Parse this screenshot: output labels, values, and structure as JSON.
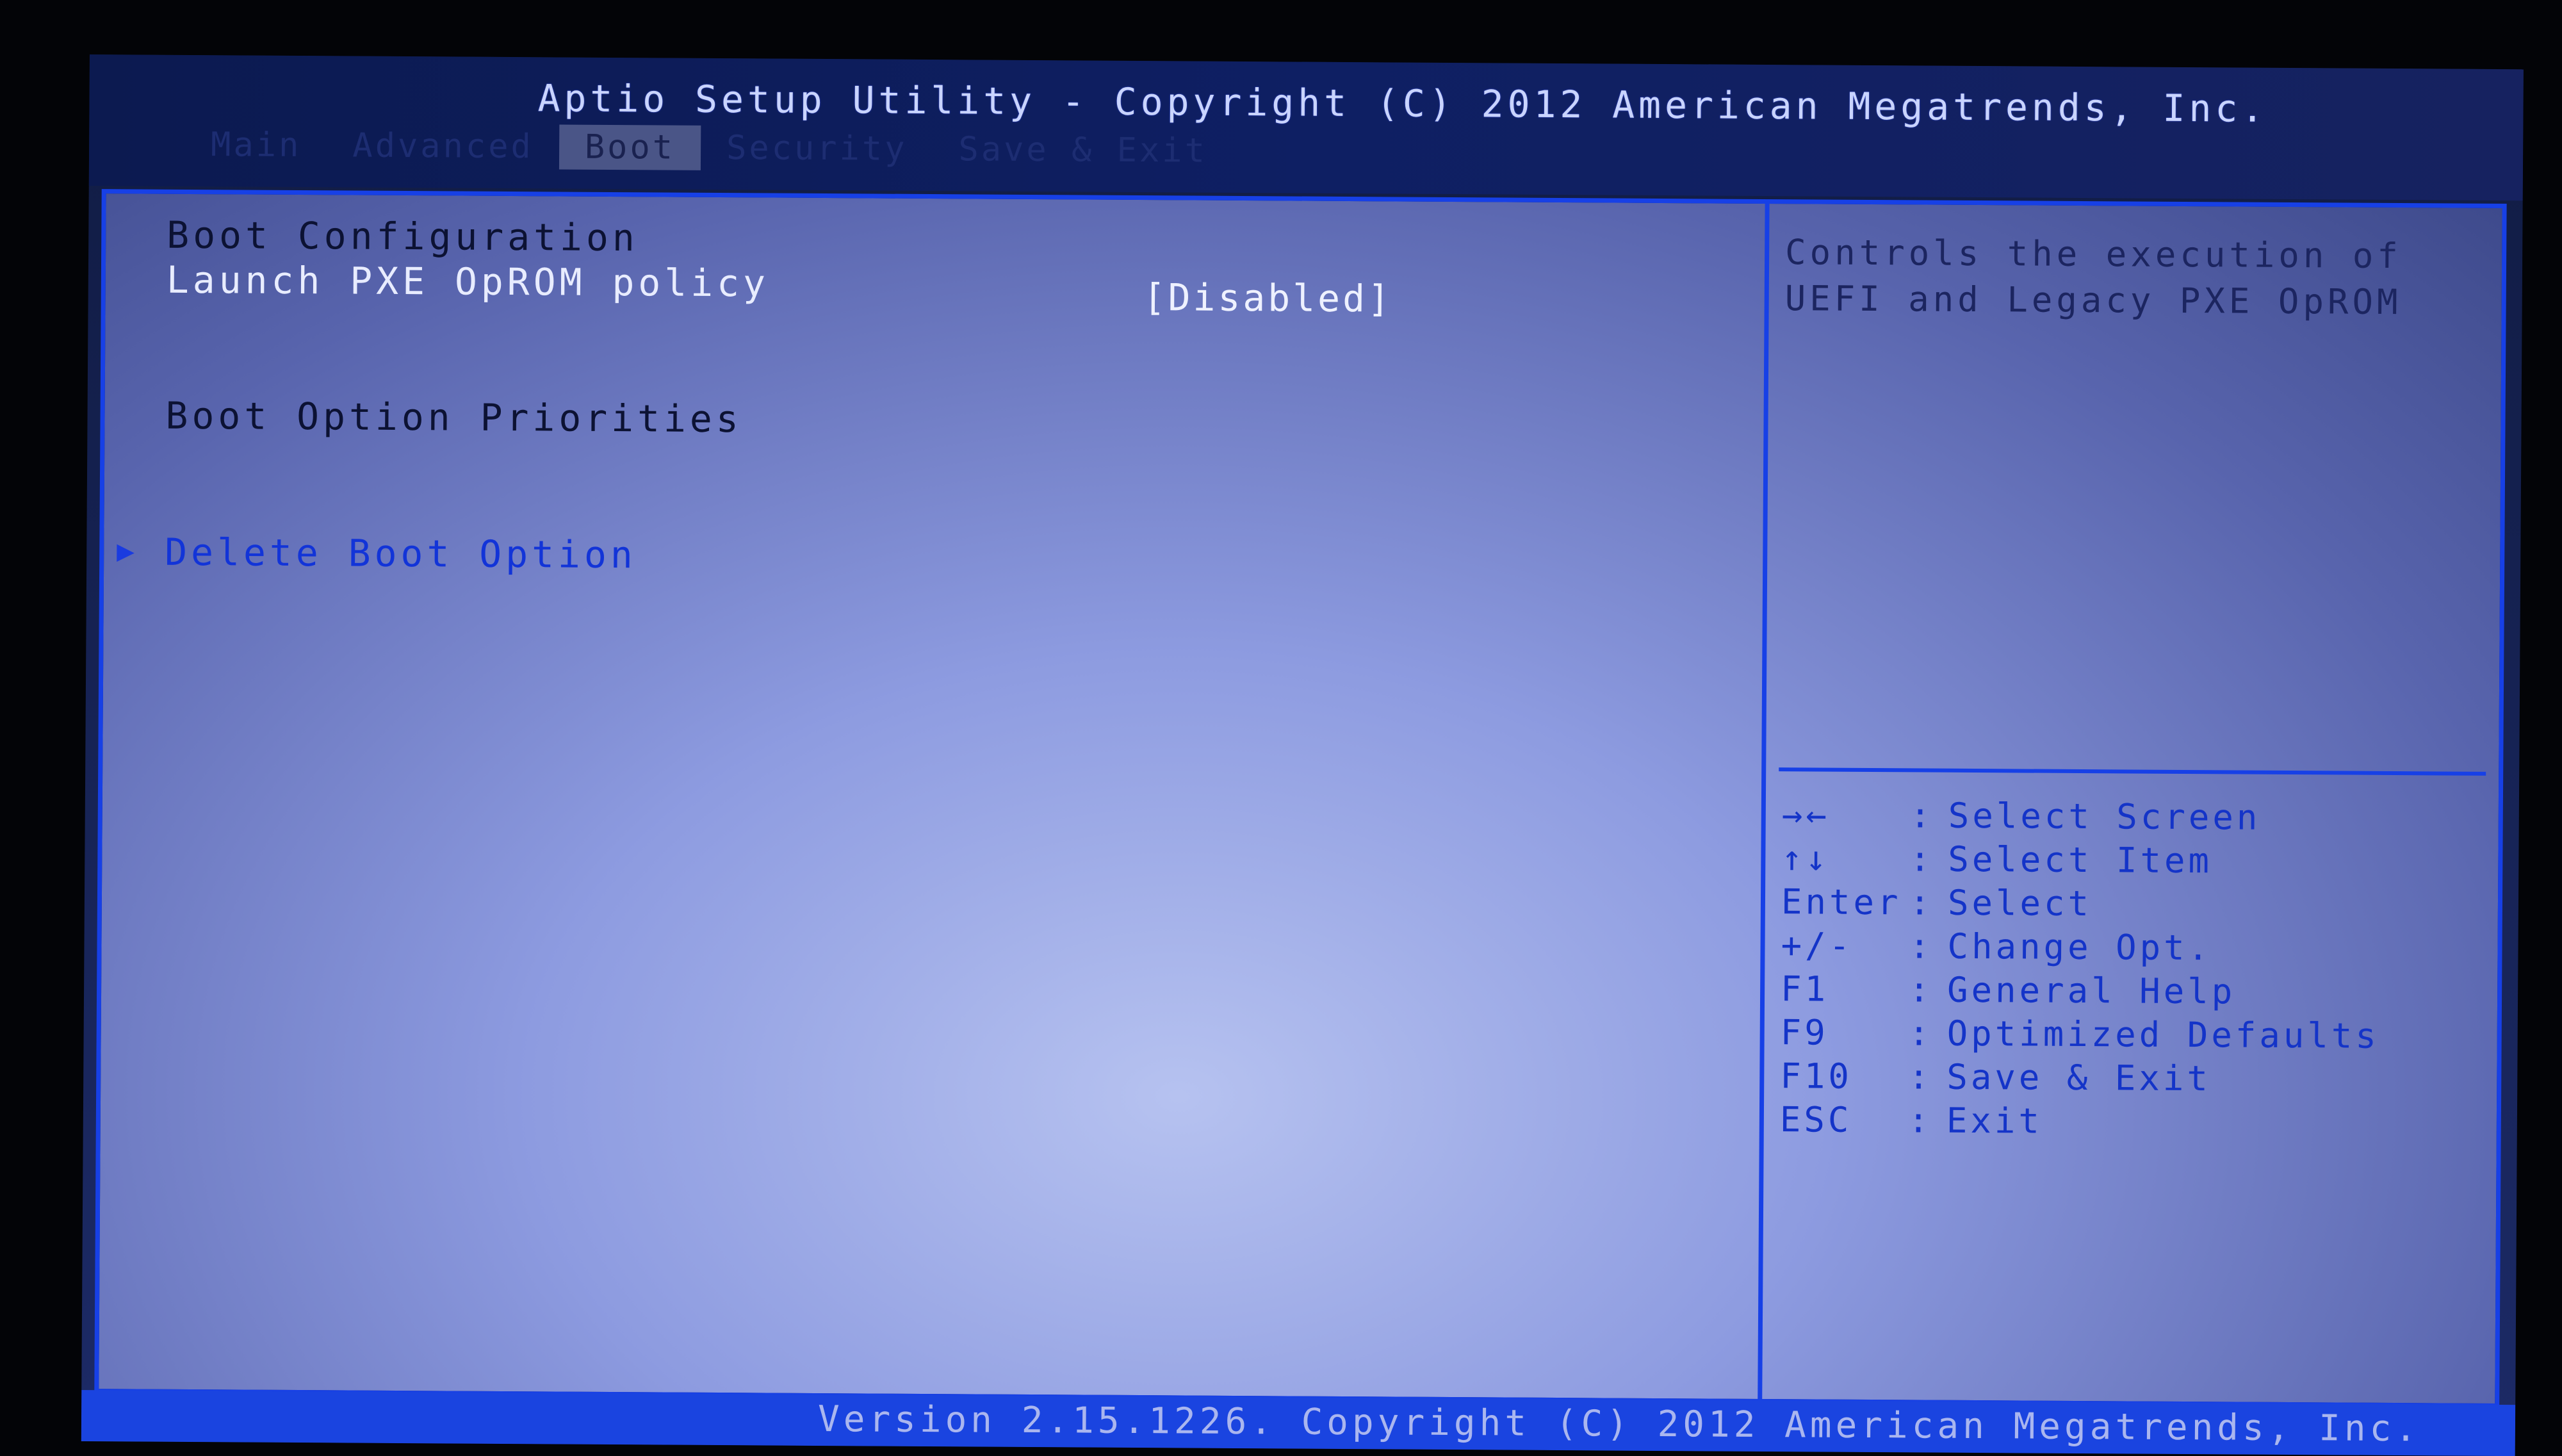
{
  "header": {
    "title": "Aptio Setup Utility - Copyright (C) 2012 American Megatrends, Inc."
  },
  "tabs": [
    {
      "label": "Main",
      "active": false
    },
    {
      "label": "Advanced",
      "active": false
    },
    {
      "label": "Boot",
      "active": true
    },
    {
      "label": "Security",
      "active": false
    },
    {
      "label": "Save & Exit",
      "active": false
    }
  ],
  "main": {
    "boot_configuration_heading": "Boot Configuration",
    "pxe_policy": {
      "label": "Launch PXE OpROM policy",
      "value": "[Disabled]"
    },
    "boot_priorities_heading": "Boot Option Priorities",
    "delete_boot_option": {
      "label": "Delete Boot Option",
      "icon": "submenu-arrow-icon"
    }
  },
  "help": {
    "description": "Controls the execution of UEFI and Legacy PXE OpROM",
    "keys": [
      {
        "key": "→←",
        "sep": ":",
        "action": "Select Screen"
      },
      {
        "key": "↑↓",
        "sep": ":",
        "action": "Select Item"
      },
      {
        "key": "Enter",
        "sep": ":",
        "action": "Select"
      },
      {
        "key": "+/-",
        "sep": ":",
        "action": "Change Opt."
      },
      {
        "key": "F1",
        "sep": ":",
        "action": "General Help"
      },
      {
        "key": "F9",
        "sep": ":",
        "action": "Optimized Defaults"
      },
      {
        "key": "F10",
        "sep": ":",
        "action": "Save & Exit"
      },
      {
        "key": "ESC",
        "sep": ":",
        "action": "Exit"
      }
    ]
  },
  "footer": {
    "text": "Version 2.15.1226. Copyright (C) 2012 American Megatrends, Inc."
  },
  "colors": {
    "accent_border": "#1740e6",
    "submenu_text": "#1234d8",
    "footer_bar": "#1a44e0"
  }
}
